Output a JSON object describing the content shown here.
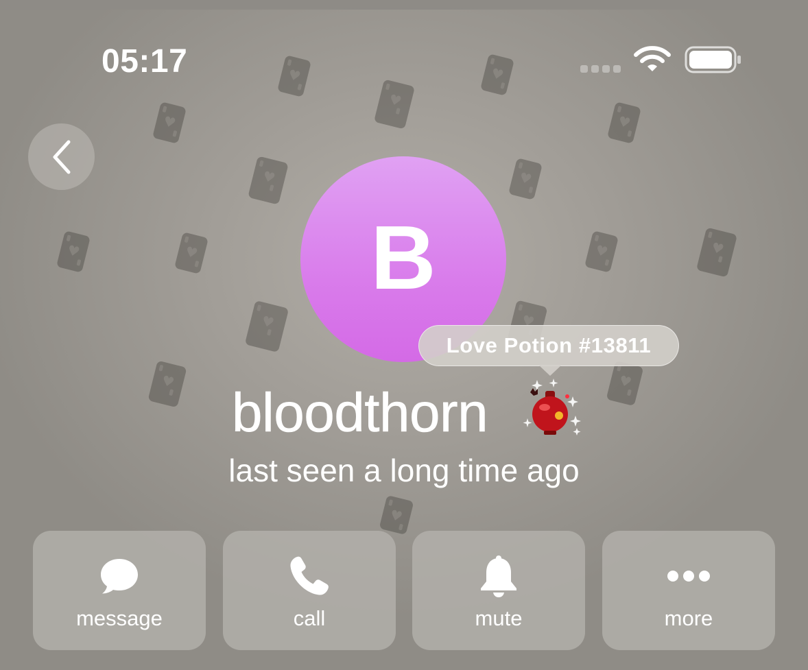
{
  "status_bar": {
    "time": "05:17",
    "icons": [
      "signal-icon",
      "wifi-icon",
      "battery-icon"
    ]
  },
  "navigation": {
    "back_icon": "chevron-left-icon"
  },
  "profile": {
    "avatar_initial": "B",
    "avatar_colors": [
      "#e0a1f3",
      "#d46ae6"
    ],
    "name": "bloodthorn",
    "status": "last seen a long time ago",
    "gift_tooltip": "Love Potion #13811",
    "emoji_status_icon": "love-potion-icon"
  },
  "actions": [
    {
      "label": "message",
      "icon": "chat-bubble-icon"
    },
    {
      "label": "call",
      "icon": "phone-icon"
    },
    {
      "label": "mute",
      "icon": "bell-icon"
    },
    {
      "label": "more",
      "icon": "ellipsis-icon"
    }
  ],
  "colors": {
    "background": "#a29e98",
    "button_fill": "#b5b2ad",
    "text": "#ffffff"
  }
}
